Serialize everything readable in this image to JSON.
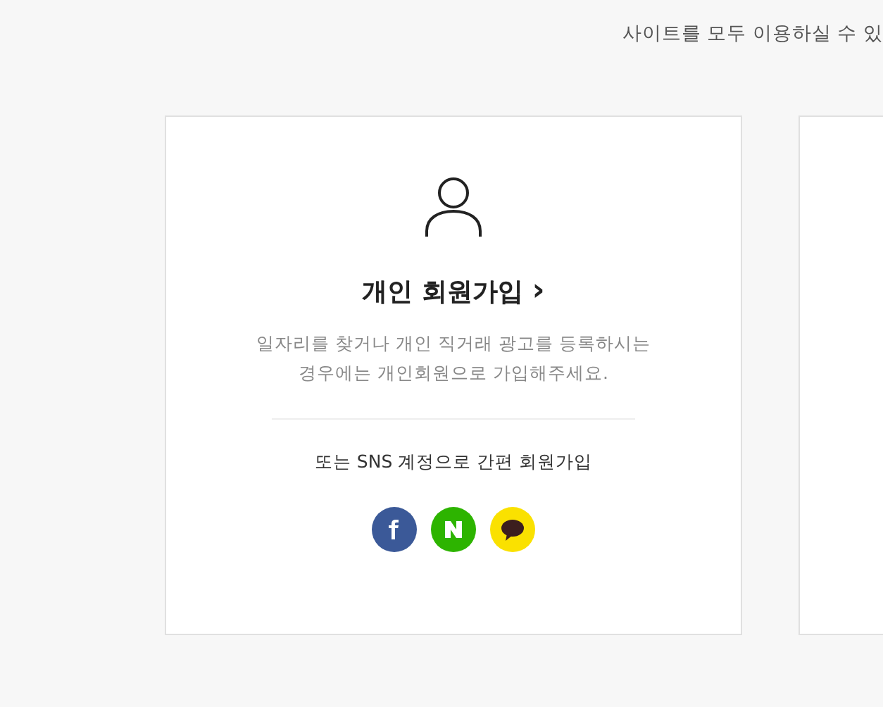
{
  "intro_text": "사이트를 모두 이용하실 수 있",
  "personal_card": {
    "title": "개인 회원가입",
    "title_arrow": "›",
    "description": "일자리를 찾거나 개인 직거래 광고를 등록하시는\n경우에는 개인회원으로 가입해주세요.",
    "sns_label": "또는 SNS 계정으로 간편 회원가입",
    "sns_buttons": [
      {
        "kind": "facebook",
        "color": "#3b5998"
      },
      {
        "kind": "naver",
        "color": "#2db400"
      },
      {
        "kind": "kakao",
        "color": "#fae100"
      }
    ]
  }
}
